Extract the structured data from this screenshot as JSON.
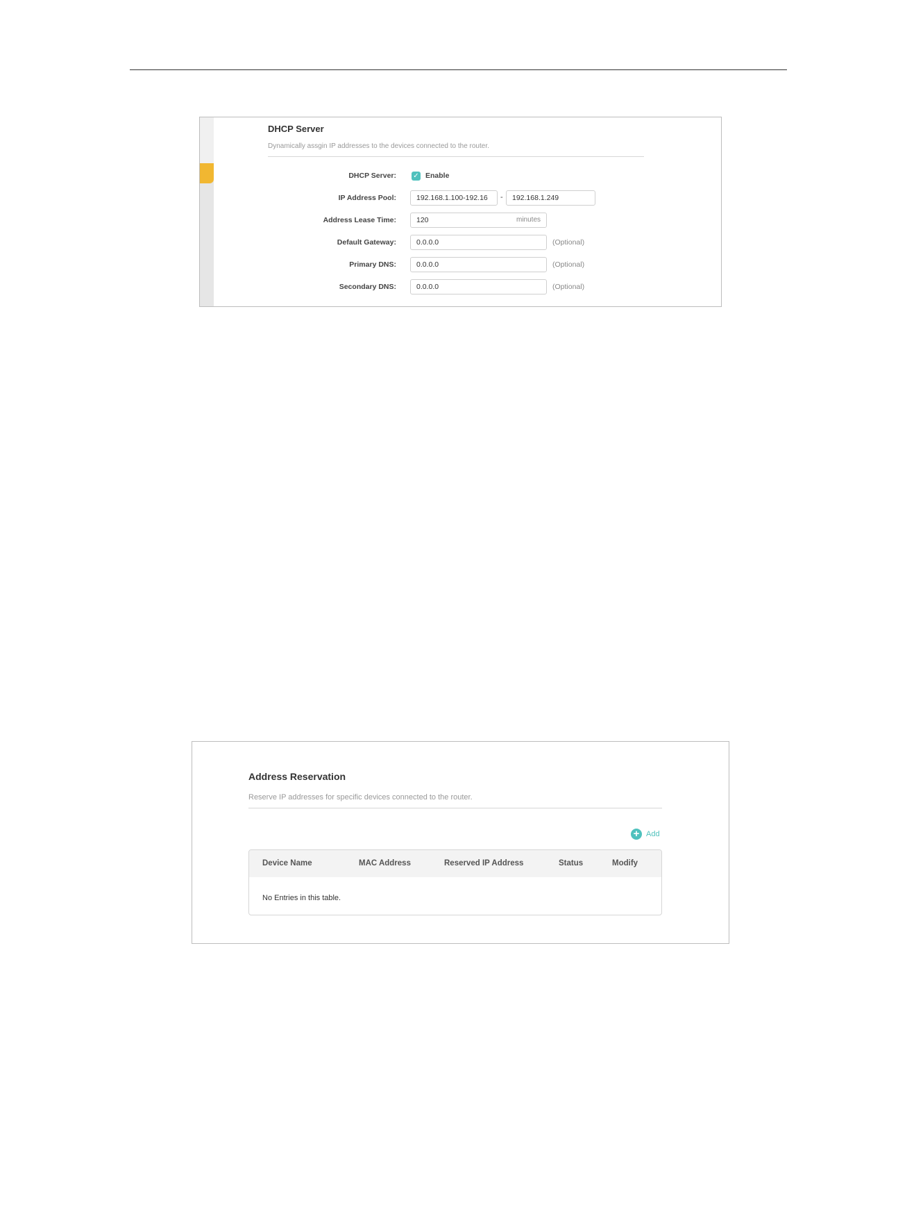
{
  "dhcp": {
    "title": "DHCP Server",
    "subtitle": "Dynamically assgin IP addresses to the devices connected to the router.",
    "fields": {
      "server_label": "DHCP Server:",
      "enable_label": "Enable",
      "enable_checked": "✓",
      "pool_label": "IP Address Pool:",
      "pool_start": "192.168.1.100-192.16",
      "pool_dash": "-",
      "pool_end": "192.168.1.249",
      "lease_label": "Address Lease Time:",
      "lease_value": "120",
      "lease_unit": "minutes",
      "gateway_label": "Default Gateway:",
      "gateway_value": "0.0.0.0",
      "primary_dns_label": "Primary DNS:",
      "primary_dns_value": "0.0.0.0",
      "secondary_dns_label": "Secondary DNS:",
      "secondary_dns_value": "0.0.0.0",
      "optional": "(Optional)"
    },
    "accent_color": "#f1b731",
    "check_color": "#4fc1bd"
  },
  "reservation": {
    "title": "Address Reservation",
    "subtitle": "Reserve IP addresses for specific devices connected to the router.",
    "add_label": "Add",
    "columns": [
      "Device Name",
      "MAC Address",
      "Reserved IP Address",
      "Status",
      "Modify"
    ],
    "empty_text": "No Entries in this table.",
    "accent_color": "#4fc1bd"
  }
}
